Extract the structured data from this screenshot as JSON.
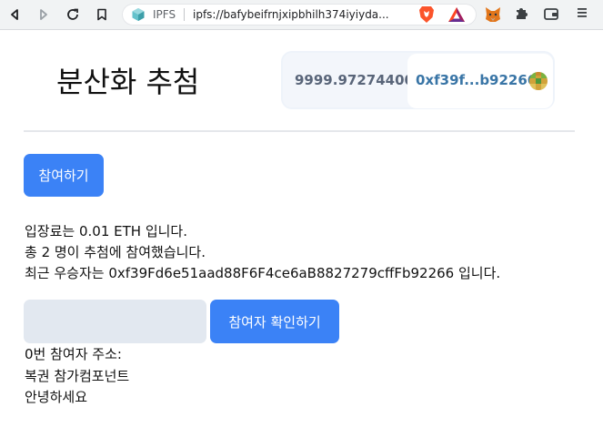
{
  "browser": {
    "site_label": "IPFS",
    "url": "ipfs://bafybeifrnjxipbhilh374iyiyda...",
    "icons": [
      "back-icon",
      "forward-icon",
      "reload-icon",
      "bookmark-icon",
      "ipfs-cube-icon",
      "brave-shield-icon",
      "bat-rewards-icon",
      "metamask-icon",
      "extensions-puzzle-icon",
      "wallet-icon",
      "menu-icon"
    ]
  },
  "header": {
    "title": "분산화 추첨",
    "balance": "9999.97274400",
    "address": "0xf39f...b92266"
  },
  "main": {
    "join_button": "참여하기",
    "info_lines": [
      "입장료는 0.01 ETH 입니다.",
      "총 2 명이 추첨에 참여했습니다.",
      "최근 우승자는 0xf39Fd6e51aad88F6F4ce6aB8827279cffFb92266 입니다."
    ],
    "index_input": {
      "value": "",
      "placeholder": ""
    },
    "check_button": "참여자 확인하기",
    "result_lines": [
      "0번 참여자 주소:",
      "복권 참가컴포넌트",
      "안녕하세요"
    ]
  },
  "colors": {
    "primary_button": "#3b82f6",
    "address_text": "#3975a6",
    "balance_text": "#596579",
    "input_bg": "#e2e8f0",
    "account_box_bg": "#f3f6fb"
  }
}
